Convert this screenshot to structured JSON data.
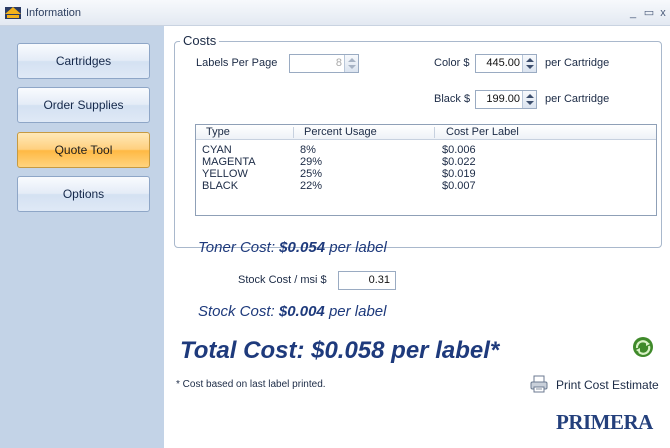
{
  "window": {
    "title": "Information"
  },
  "sidebar": {
    "items": [
      {
        "label": "Cartridges",
        "active": false
      },
      {
        "label": "Order Supplies",
        "active": false
      },
      {
        "label": "Quote Tool",
        "active": true
      },
      {
        "label": "Options",
        "active": false
      }
    ]
  },
  "costs": {
    "group_label": "Costs",
    "labels_per_page": {
      "label": "Labels Per Page",
      "value": "8"
    },
    "color": {
      "label": "Color $",
      "value": "445.00",
      "suffix": "per Cartridge"
    },
    "black": {
      "label": "Black $",
      "value": "199.00",
      "suffix": "per Cartridge"
    },
    "table": {
      "headers": [
        "Type",
        "Percent Usage",
        "Cost Per Label"
      ],
      "rows": [
        [
          "CYAN",
          "8%",
          "$0.006"
        ],
        [
          "MAGENTA",
          "29%",
          "$0.022"
        ],
        [
          "YELLOW",
          "25%",
          "$0.019"
        ],
        [
          "BLACK",
          "22%",
          "$0.007"
        ]
      ]
    }
  },
  "toner": {
    "prefix": "Toner Cost:",
    "value": "$0.054",
    "suffix": "per label"
  },
  "stock_input": {
    "label": "Stock Cost / msi $",
    "value": "0.31"
  },
  "stock": {
    "prefix": "Stock Cost:",
    "value": "$0.004",
    "suffix": "per label"
  },
  "total": {
    "text": "Total Cost: $0.058 per label*"
  },
  "footnote": "* Cost based on last label printed.",
  "print_button": {
    "label": "Print Cost Estimate"
  },
  "logo": "PRIMERA",
  "colors": {
    "accent": "#ffb944",
    "brand": "#24407c",
    "sidebar": "#c3d3e7"
  },
  "icons": {
    "app": "primera-app-icon",
    "recycle": "recycle-icon",
    "print": "printer-icon"
  }
}
